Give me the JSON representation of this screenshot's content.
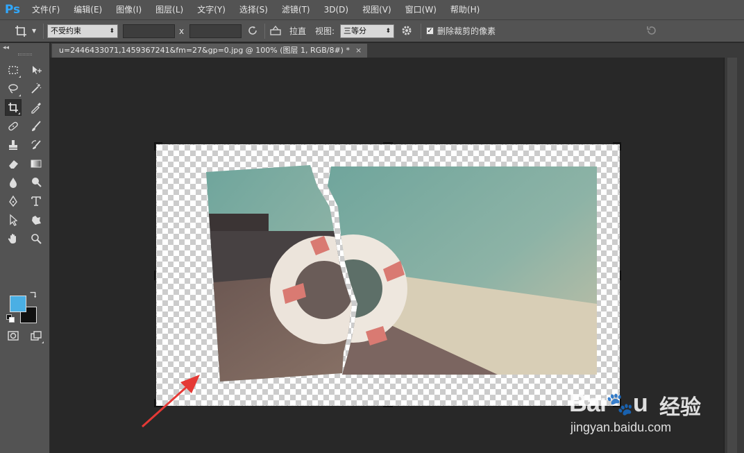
{
  "app": {
    "logo": "Ps"
  },
  "menu": [
    "文件(F)",
    "编辑(E)",
    "图像(I)",
    "图层(L)",
    "文字(Y)",
    "选择(S)",
    "滤镜(T)",
    "3D(D)",
    "视图(V)",
    "窗口(W)",
    "帮助(H)"
  ],
  "options": {
    "ratio_select": "不受约束",
    "x_separator": "x",
    "straighten_label": "拉直",
    "view_label": "视图:",
    "view_select": "三等分",
    "delete_cropped_label": "删除裁剪的像素",
    "delete_cropped_checked": true
  },
  "document": {
    "tab_title": "u=2446433071,1459367241&fm=27&gp=0.jpg @ 100% (图层 1, RGB/8#) *",
    "close_glyph": "×"
  },
  "colors": {
    "foreground": "#4aafe4",
    "background": "#111111",
    "app_accent": "#31a8ff",
    "annotation_arrow": "#e53935"
  },
  "watermark": {
    "brand": "Bai",
    "brand_suffix": "u",
    "cn": "经验",
    "url": "jingyan.baidu.com"
  }
}
